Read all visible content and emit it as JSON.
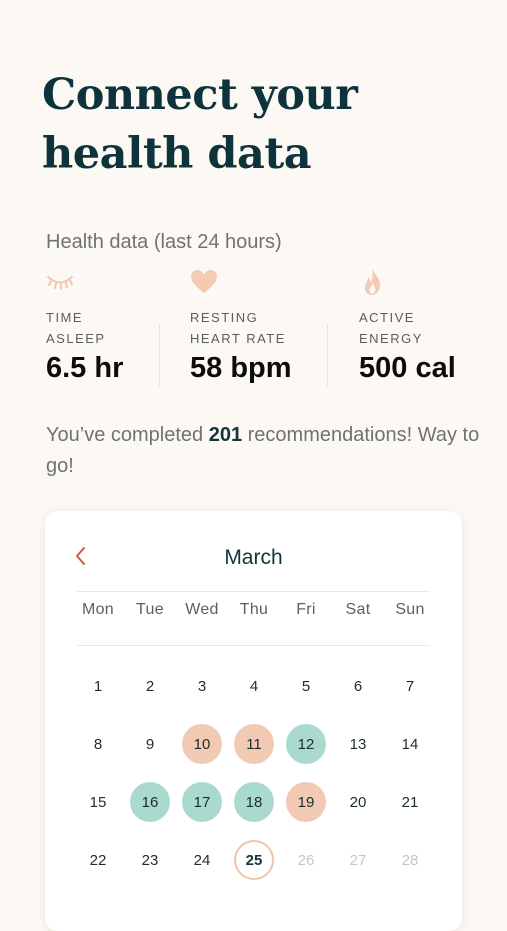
{
  "header": {
    "title": "Connect your health data"
  },
  "health": {
    "section_title": "Health data (last 24 hours)",
    "metrics": [
      {
        "label_line1": "TIME",
        "label_line2": "ASLEEP",
        "value": "6.5 hr",
        "icon": "sleep-eye-icon",
        "icon_color": "#f1c8ad"
      },
      {
        "label_line1": "RESTING",
        "label_line2": "HEART RATE",
        "value": "58 bpm",
        "icon": "heart-icon",
        "icon_color": "#f4cbb2"
      },
      {
        "label_line1": "ACTIVE",
        "label_line2": "ENERGY",
        "value": "500 cal",
        "icon": "flame-icon",
        "icon_color": "#f4cbb2"
      }
    ]
  },
  "completed": {
    "prefix": "You’ve completed ",
    "count": "201",
    "suffix": " recommendations! Way to go!"
  },
  "calendar": {
    "month": "March",
    "prev_icon": "chevron-left-icon",
    "weekdays": [
      "Mon",
      "Tue",
      "Wed",
      "Thu",
      "Fri",
      "Sat",
      "Sun"
    ],
    "colors": {
      "peach": "#f2c9b2",
      "teal": "#a9d9cf",
      "chevron": "#d2564d"
    },
    "weeks": [
      [
        {
          "day": "1"
        },
        {
          "day": "2"
        },
        {
          "day": "3"
        },
        {
          "day": "4"
        },
        {
          "day": "5"
        },
        {
          "day": "6"
        },
        {
          "day": "7"
        }
      ],
      [
        {
          "day": "8"
        },
        {
          "day": "9"
        },
        {
          "day": "10",
          "state": "peach"
        },
        {
          "day": "11",
          "state": "peach"
        },
        {
          "day": "12",
          "state": "teal"
        },
        {
          "day": "13"
        },
        {
          "day": "14"
        }
      ],
      [
        {
          "day": "15"
        },
        {
          "day": "16",
          "state": "teal"
        },
        {
          "day": "17",
          "state": "teal"
        },
        {
          "day": "18",
          "state": "teal"
        },
        {
          "day": "19",
          "state": "peach"
        },
        {
          "day": "20"
        },
        {
          "day": "21"
        }
      ],
      [
        {
          "day": "22"
        },
        {
          "day": "23"
        },
        {
          "day": "24"
        },
        {
          "day": "25",
          "state": "today"
        },
        {
          "day": "26",
          "state": "future"
        },
        {
          "day": "27",
          "state": "future"
        },
        {
          "day": "28",
          "state": "future"
        }
      ]
    ]
  }
}
